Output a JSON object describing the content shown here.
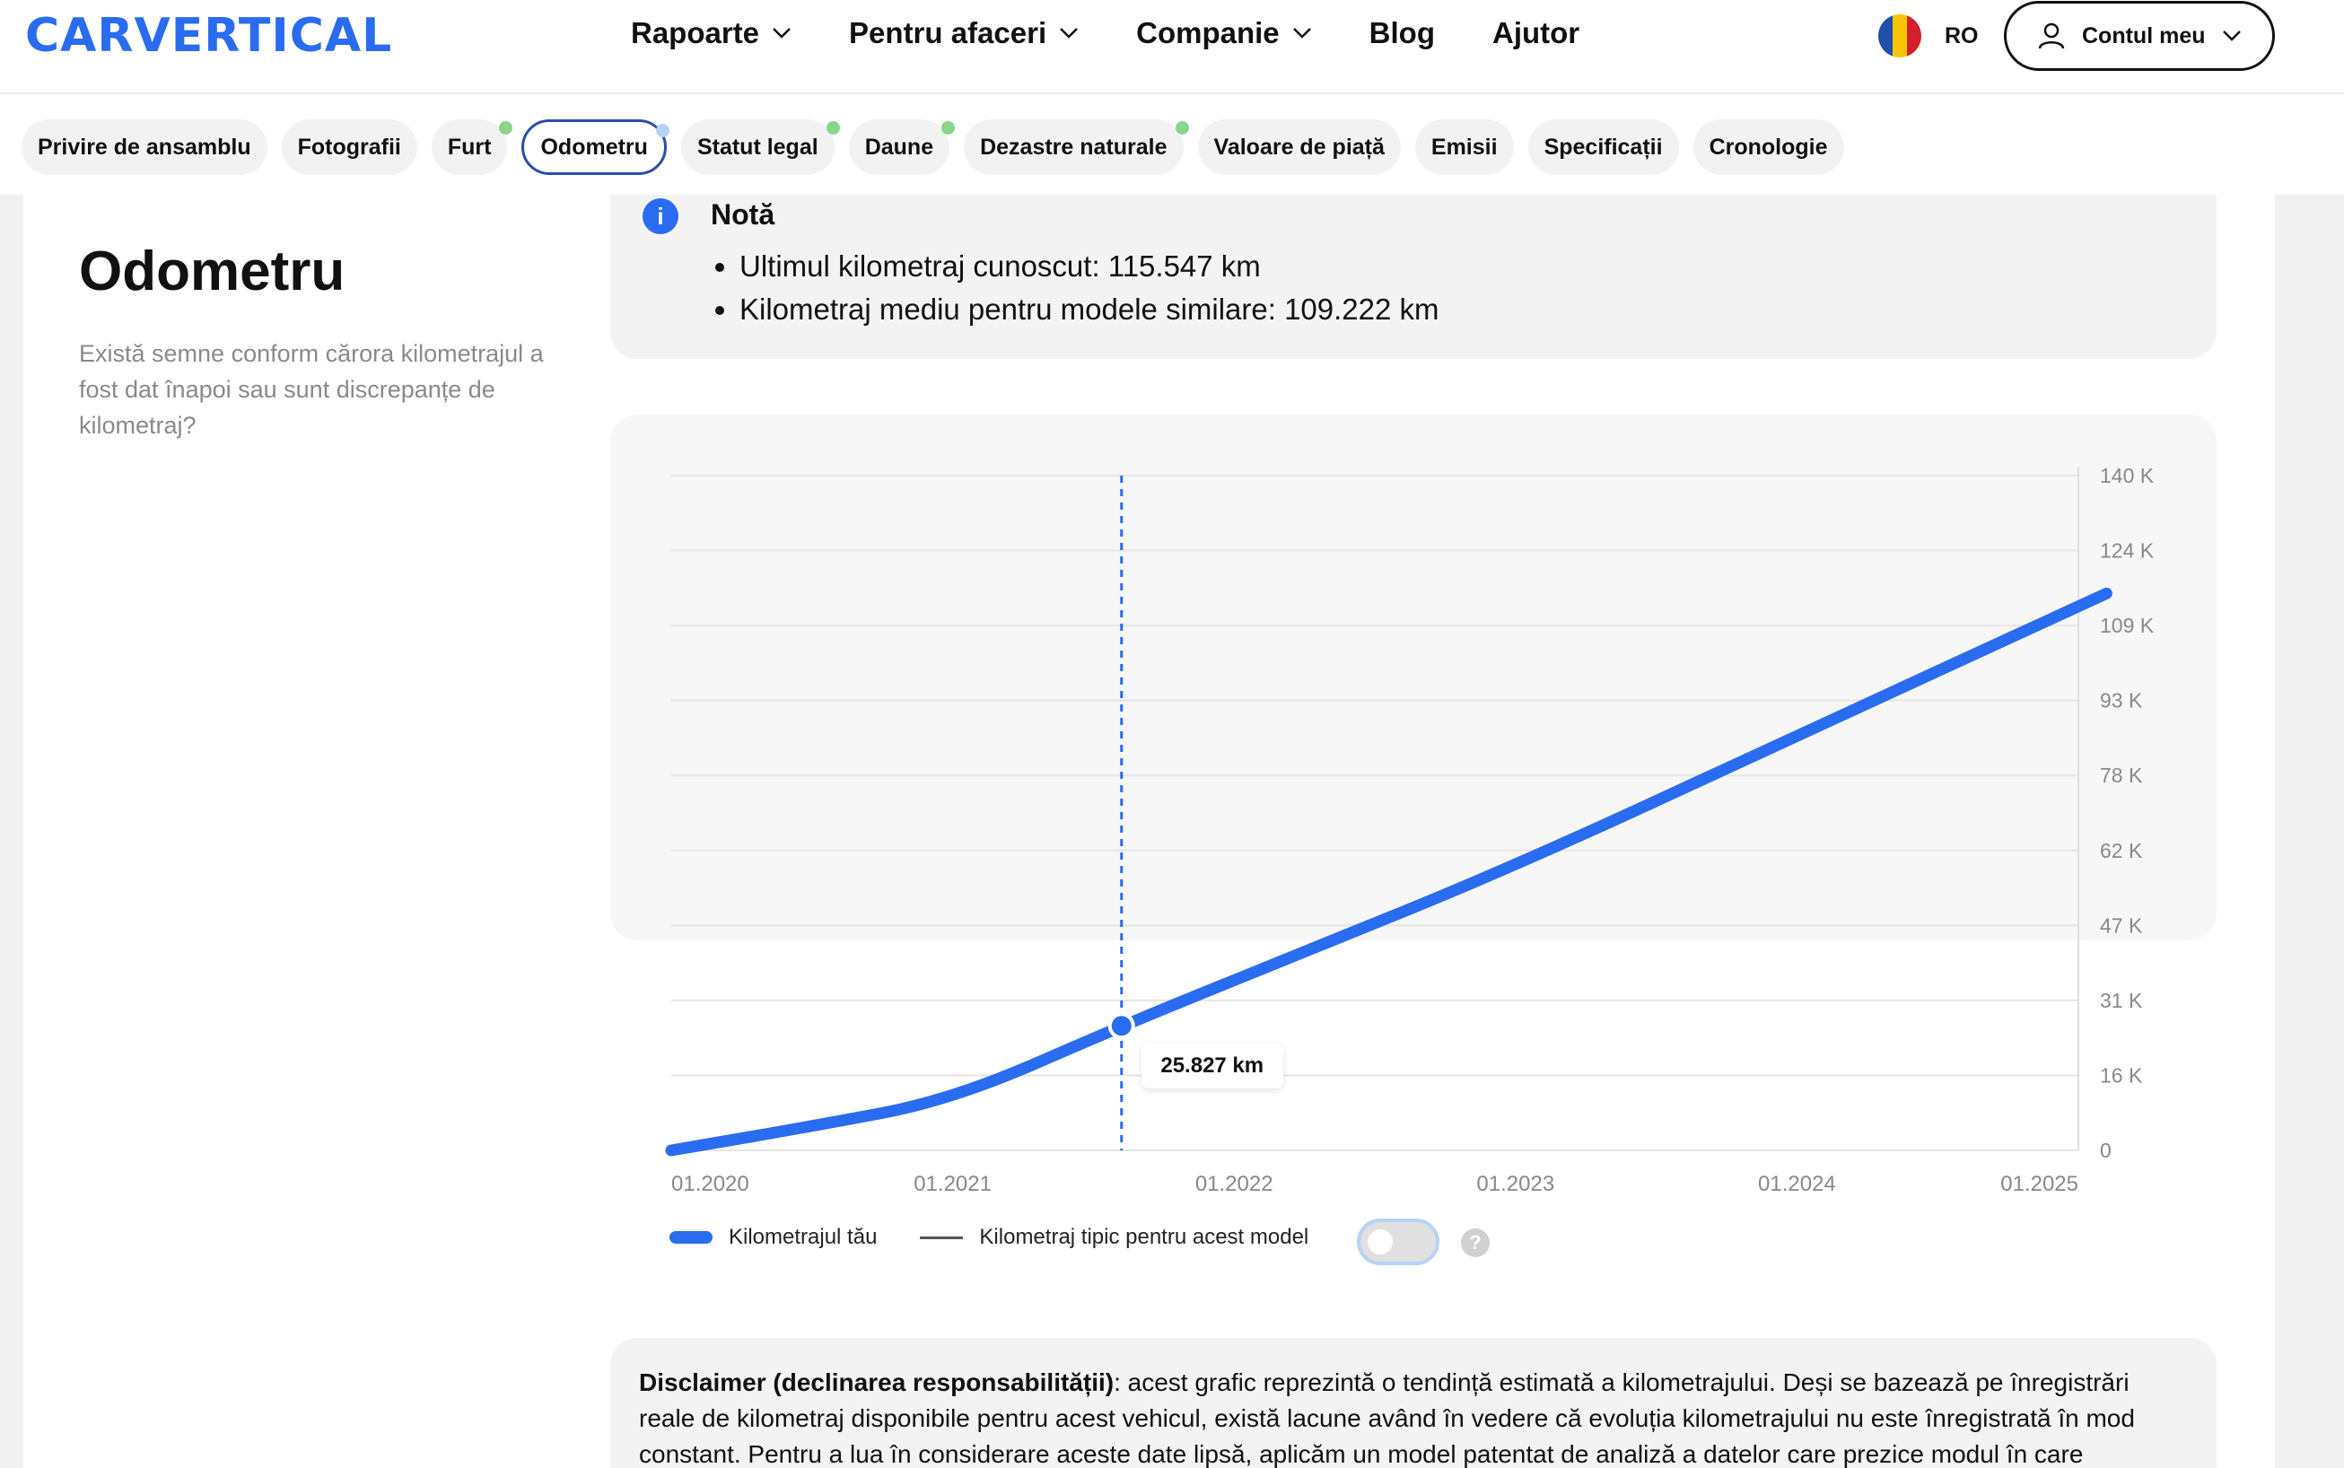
{
  "header": {
    "logo": "CARVERTICAL",
    "nav": [
      {
        "label": "Rapoarte",
        "dropdown": true
      },
      {
        "label": "Pentru afaceri",
        "dropdown": true
      },
      {
        "label": "Companie",
        "dropdown": true
      },
      {
        "label": "Blog",
        "dropdown": false
      },
      {
        "label": "Ajutor",
        "dropdown": false
      }
    ],
    "language": "RO",
    "account_label": "Contul meu"
  },
  "tabs": [
    {
      "label": "Privire de ansamblu",
      "dot": ""
    },
    {
      "label": "Fotografii",
      "dot": ""
    },
    {
      "label": "Furt",
      "dot": "green"
    },
    {
      "label": "Odometru",
      "dot": "blue",
      "active": true
    },
    {
      "label": "Statut legal",
      "dot": "green"
    },
    {
      "label": "Daune",
      "dot": "green"
    },
    {
      "label": "Dezastre naturale",
      "dot": "green"
    },
    {
      "label": "Valoare de piață",
      "dot": ""
    },
    {
      "label": "Emisii",
      "dot": ""
    },
    {
      "label": "Specificații",
      "dot": ""
    },
    {
      "label": "Cronologie",
      "dot": ""
    }
  ],
  "section": {
    "title": "Odometru",
    "description": "Există semne conform cărora kilometrajul a fost dat înapoi sau sunt discrepanțe de kilometraj?"
  },
  "note": {
    "icon": "i",
    "title": "Notă",
    "items": [
      "Ultimul kilometraj cunoscut: 115.547 km",
      "Kilometraj mediu pentru modele similare: 109.222 km"
    ]
  },
  "chart_data": {
    "type": "line",
    "x_tick_labels": [
      "01.2020",
      "01.2021",
      "01.2022",
      "01.2023",
      "01.2024",
      "01.2025"
    ],
    "y_tick_labels": [
      "0",
      "16 K",
      "31 K",
      "47 K",
      "62 K",
      "78 K",
      "93 K",
      "109 K",
      "124 K",
      "140 K"
    ],
    "ylim": [
      0,
      140000
    ],
    "series": [
      {
        "name": "Kilometrajul tău",
        "color": "#2a6cf0",
        "points": [
          {
            "x": 2020.0,
            "y": 0
          },
          {
            "x": 2020.5,
            "y": 5000
          },
          {
            "x": 2021.0,
            "y": 10500
          },
          {
            "x": 2021.6,
            "y": 25827
          },
          {
            "x": 2022.2,
            "y": 40000
          },
          {
            "x": 2023.0,
            "y": 59000
          },
          {
            "x": 2024.0,
            "y": 86000
          },
          {
            "x": 2025.1,
            "y": 115547
          }
        ]
      }
    ],
    "highlight": {
      "x": 2021.6,
      "y": 25827,
      "label": "25.827 km"
    },
    "legend": [
      {
        "label": "Kilometrajul tău"
      },
      {
        "label": "Kilometraj tipic pentru acest model"
      }
    ],
    "grid": true
  },
  "disclaimer": {
    "bold": "Disclaimer (declinarea responsabilității)",
    "text": ": acest grafic reprezintă o tendință estimată a kilometrajului. Deși se bazează pe înregistrări reale de kilometraj disponibile pentru acest vehicul, există lacune având în vedere că evoluția kilometrajului nu este înregistrată în mod constant. Pentru a lua în considerare aceste date lipsă, aplicăm un model patentat de analiză a datelor care prezice modul în care"
  },
  "colors": {
    "brand": "#2a6cf0",
    "active_tab_border": "#2a4fa8",
    "dot_green": "#8ad48a"
  }
}
